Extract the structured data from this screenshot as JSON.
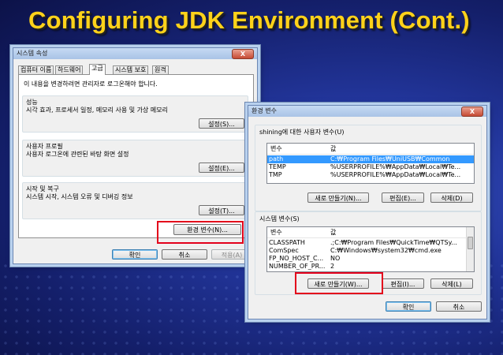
{
  "slide": {
    "title": "Configuring JDK Environment (Cont.)"
  },
  "sysprops": {
    "title": "시스템 속성",
    "close": "X",
    "tabs": [
      "컴퓨터 이름",
      "하드웨어",
      "고급",
      "시스템 보호",
      "원격"
    ],
    "notice": "이 내용을 변경하려면 관리자로 로그온해야 합니다.",
    "groups": [
      {
        "label": "성능",
        "desc": "시각 효과, 프로세서 일정, 메모리 사용 및 가상 메모리",
        "button": "설정(S)..."
      },
      {
        "label": "사용자 프로필",
        "desc": "사용자 로그온에 관련된 바탕 화면 설정",
        "button": "설정(E)..."
      },
      {
        "label": "시작 및 복구",
        "desc": "시스템 시작, 시스템 오류 및 디버깅 정보",
        "button": "설정(T)..."
      }
    ],
    "env_button": "환경 변수(N)...",
    "ok": "확인",
    "cancel": "취소",
    "apply": "적용(A)"
  },
  "envvars": {
    "title": "환경 변수",
    "close": "X",
    "user_section": "shining에 대한 사용자 변수(U)",
    "col_var": "변수",
    "col_val": "값",
    "user_vars": [
      {
        "name": "path",
        "value": "C:₩Program Files₩UniUSB₩Common"
      },
      {
        "name": "TEMP",
        "value": "%USERPROFILE%₩AppData₩Local₩Te..."
      },
      {
        "name": "TMP",
        "value": "%USERPROFILE%₩AppData₩Local₩Te..."
      }
    ],
    "user_buttons": {
      "new": "새로 만들기(N)...",
      "edit": "편집(E)...",
      "delete": "삭제(D)"
    },
    "system_section": "시스템 변수(S)",
    "system_vars": [
      {
        "name": "CLASSPATH",
        "value": ".;C:₩Program Files₩QuickTime₩QTSy..."
      },
      {
        "name": "ComSpec",
        "value": "C:₩Windows₩system32₩cmd.exe"
      },
      {
        "name": "FP_NO_HOST_C...",
        "value": "NO"
      },
      {
        "name": "NUMBER_OF_PR...",
        "value": "2"
      }
    ],
    "system_buttons": {
      "new": "새로 만들기(W)...",
      "edit": "편집(I)...",
      "delete": "삭제(L)"
    },
    "ok": "확인",
    "cancel": "취소"
  },
  "colors": {
    "title": "#ffd21a",
    "highlight": "#e3001b",
    "selection": "#3399ff"
  }
}
